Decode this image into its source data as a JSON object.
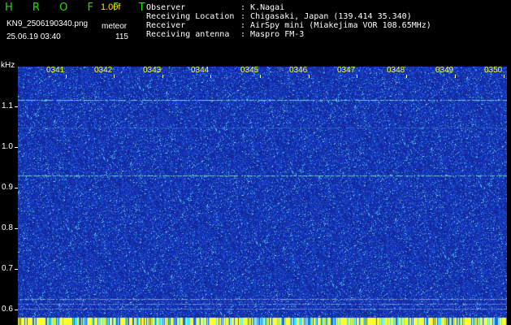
{
  "header": {
    "brand": "H R O F F T",
    "version": "1.00f",
    "filename": "KN9_2506190340.png",
    "mode": "meteor",
    "datetime": "25.06.19 03:40",
    "count": "115",
    "metadata": [
      {
        "key": "Observer",
        "value": "K.Nagai"
      },
      {
        "key": "Receiving Location",
        "value": "Chigasaki, Japan (139.414 35.340)"
      },
      {
        "key": "Receiver",
        "value": "AirSpy mini (Miakejima VOR 108.65MHz)"
      },
      {
        "key": "Receiving antenna",
        "value": "Maspro FM-3"
      }
    ]
  },
  "axes": {
    "y_unit": "kHz",
    "y_ticks": [
      "1.1",
      "1.0",
      "0.9",
      "0.8",
      "0.7",
      "0.6"
    ],
    "x_ticks": [
      "0341",
      "0342",
      "0343",
      "0344",
      "0345",
      "0346",
      "0347",
      "0348",
      "0349",
      "0350"
    ]
  },
  "colors": {
    "background": "#000000",
    "brand": "#22e000",
    "version": "#ffe000",
    "tick_label": "#ffff00",
    "spectrogram_base": "#1030b8"
  }
}
